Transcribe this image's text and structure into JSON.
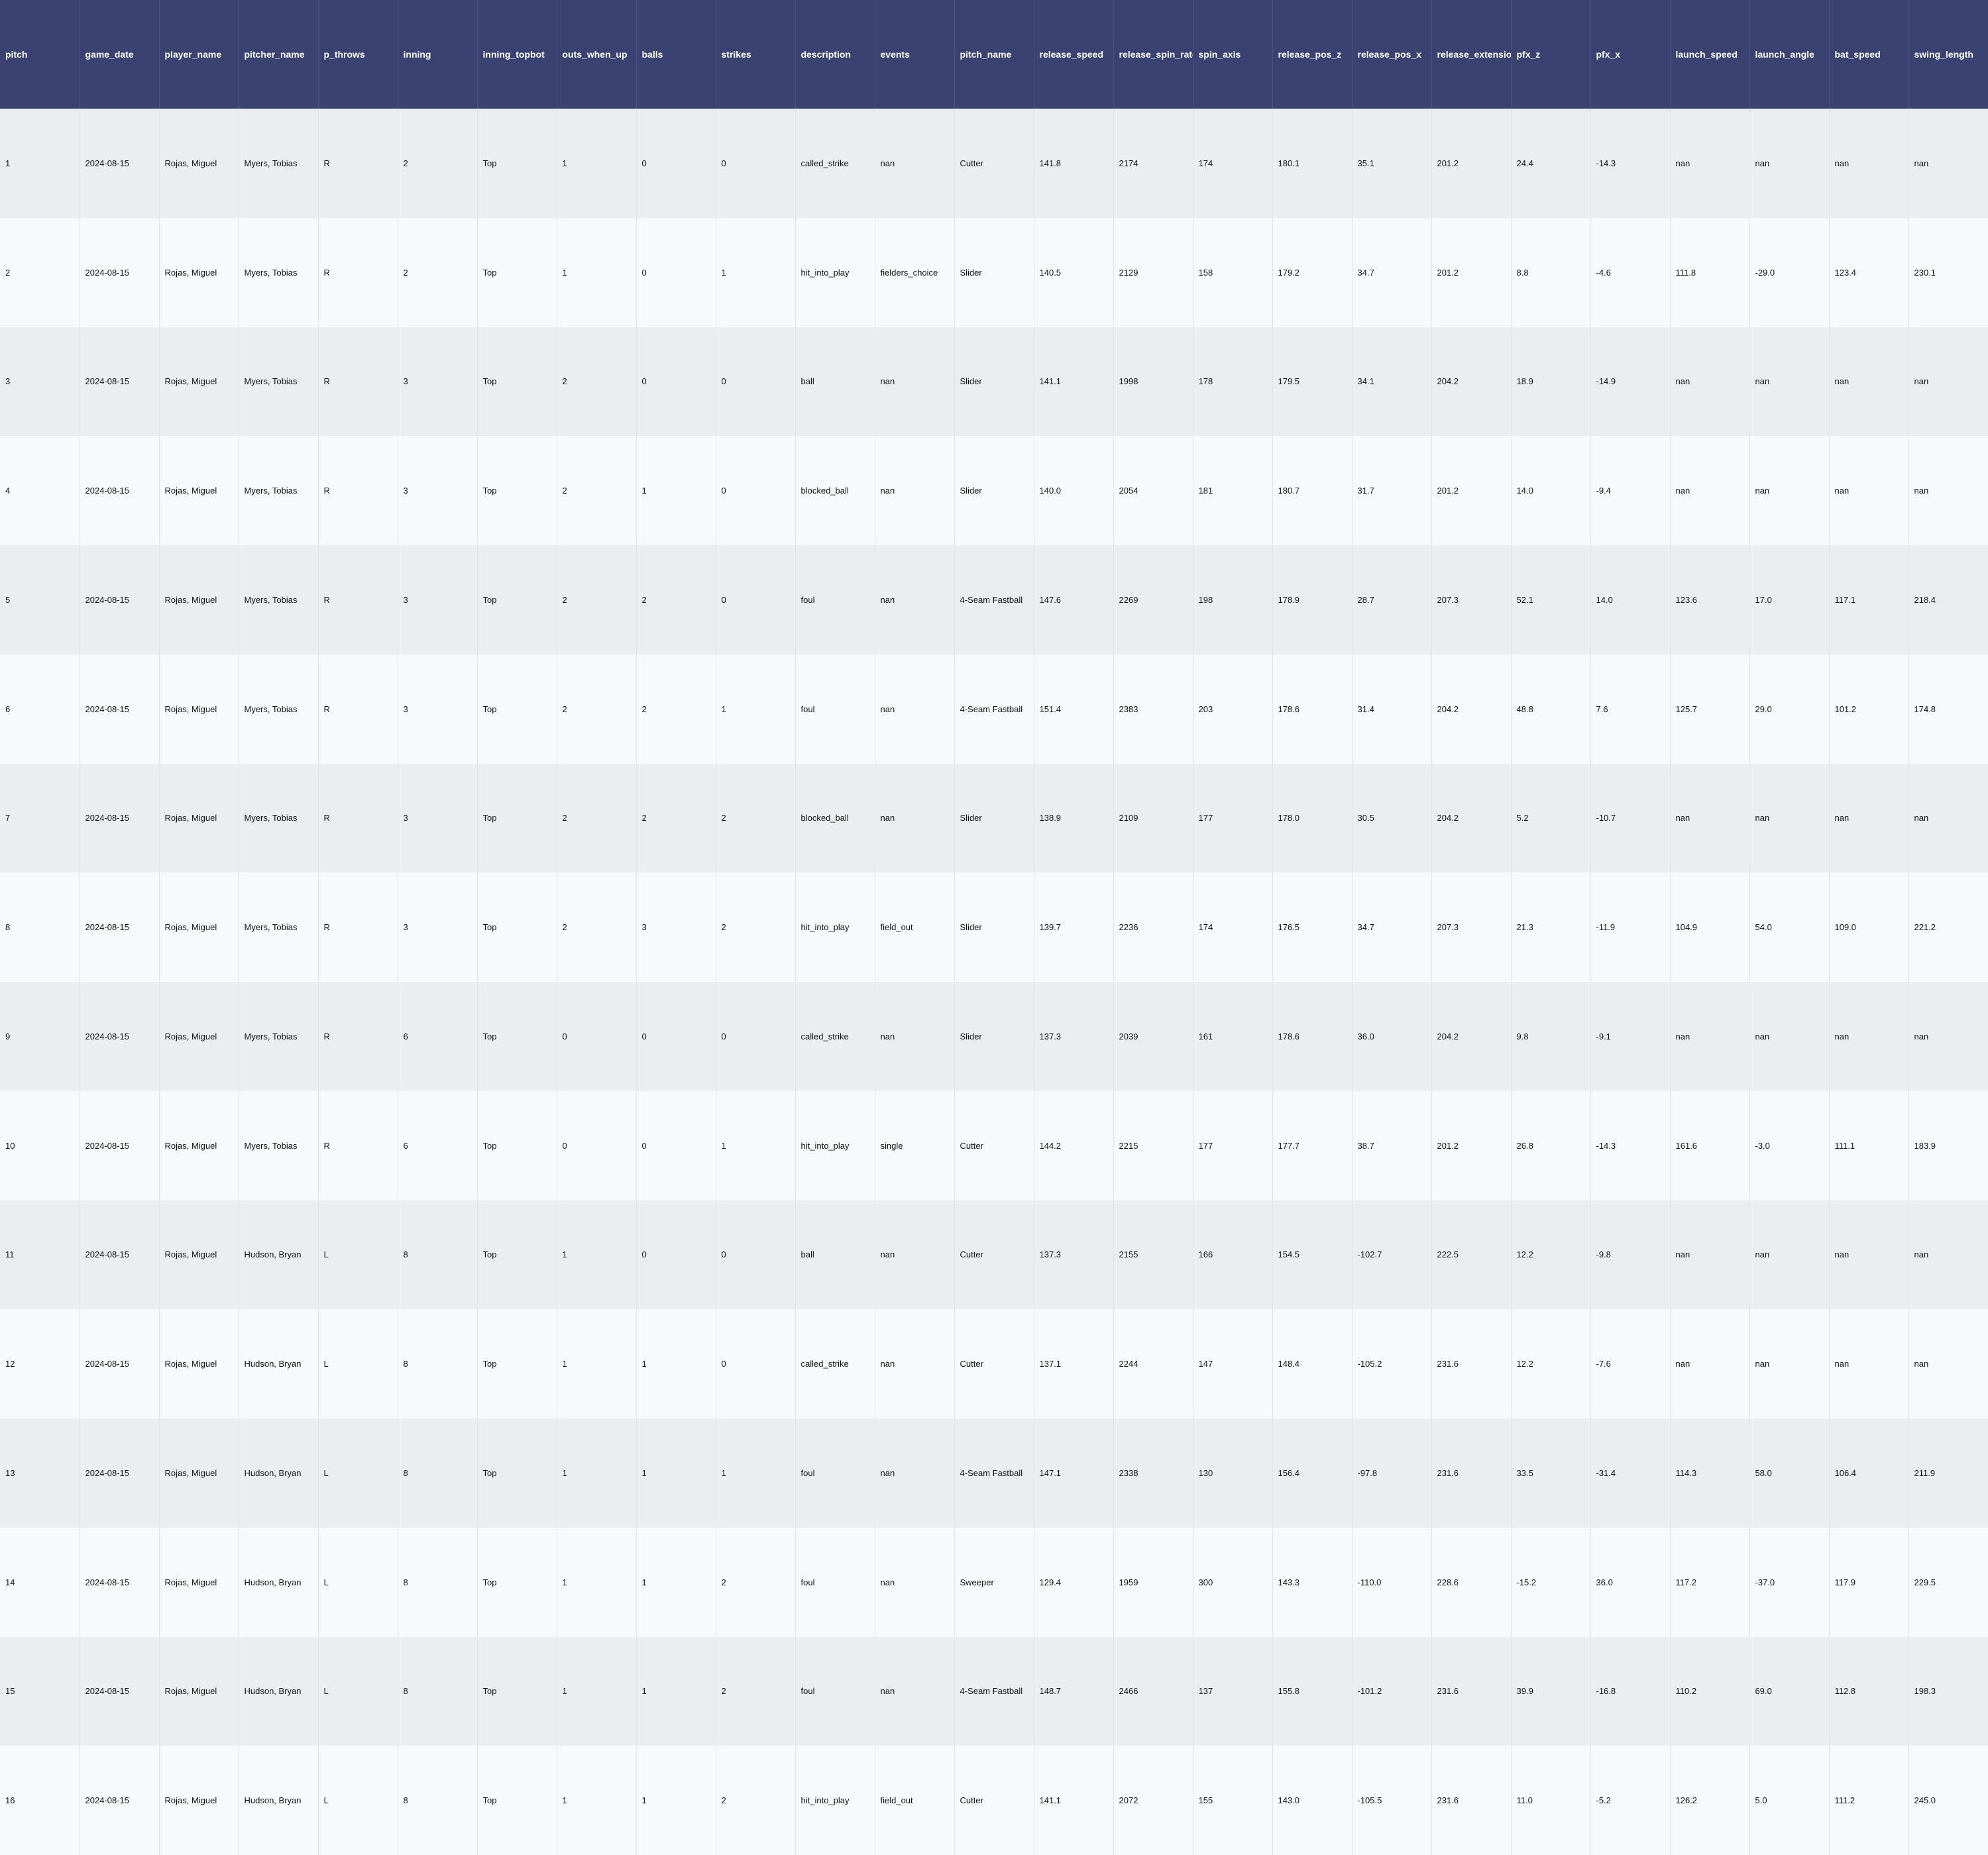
{
  "chart_data": {
    "type": "table",
    "columns": [
      "pitch",
      "game_date",
      "player_name",
      "pitcher_name",
      "p_throws",
      "inning",
      "inning_topbot",
      "outs_when_up",
      "balls",
      "strikes",
      "description",
      "events",
      "pitch_name",
      "release_speed",
      "release_spin_rate",
      "spin_axis",
      "release_pos_z",
      "release_pos_x",
      "release_extension",
      "pfx_z",
      "pfx_x",
      "launch_speed",
      "launch_angle",
      "bat_speed",
      "swing_length"
    ],
    "rows": [
      [
        "1",
        "2024-08-15",
        "Rojas, Miguel",
        "Myers, Tobias",
        "R",
        "2",
        "Top",
        "1",
        "0",
        "0",
        "called_strike",
        "nan",
        "Cutter",
        "141.8",
        "2174",
        "174",
        "180.1",
        "35.1",
        "201.2",
        "24.4",
        "-14.3",
        "nan",
        "nan",
        "nan",
        "nan"
      ],
      [
        "2",
        "2024-08-15",
        "Rojas, Miguel",
        "Myers, Tobias",
        "R",
        "2",
        "Top",
        "1",
        "0",
        "1",
        "hit_into_play",
        "fielders_choice",
        "Slider",
        "140.5",
        "2129",
        "158",
        "179.2",
        "34.7",
        "201.2",
        "8.8",
        "-4.6",
        "111.8",
        "-29.0",
        "123.4",
        "230.1"
      ],
      [
        "3",
        "2024-08-15",
        "Rojas, Miguel",
        "Myers, Tobias",
        "R",
        "3",
        "Top",
        "2",
        "0",
        "0",
        "ball",
        "nan",
        "Slider",
        "141.1",
        "1998",
        "178",
        "179.5",
        "34.1",
        "204.2",
        "18.9",
        "-14.9",
        "nan",
        "nan",
        "nan",
        "nan"
      ],
      [
        "4",
        "2024-08-15",
        "Rojas, Miguel",
        "Myers, Tobias",
        "R",
        "3",
        "Top",
        "2",
        "1",
        "0",
        "blocked_ball",
        "nan",
        "Slider",
        "140.0",
        "2054",
        "181",
        "180.7",
        "31.7",
        "201.2",
        "14.0",
        "-9.4",
        "nan",
        "nan",
        "nan",
        "nan"
      ],
      [
        "5",
        "2024-08-15",
        "Rojas, Miguel",
        "Myers, Tobias",
        "R",
        "3",
        "Top",
        "2",
        "2",
        "0",
        "foul",
        "nan",
        "4-Seam Fastball",
        "147.6",
        "2269",
        "198",
        "178.9",
        "28.7",
        "207.3",
        "52.1",
        "14.0",
        "123.6",
        "17.0",
        "117.1",
        "218.4"
      ],
      [
        "6",
        "2024-08-15",
        "Rojas, Miguel",
        "Myers, Tobias",
        "R",
        "3",
        "Top",
        "2",
        "2",
        "1",
        "foul",
        "nan",
        "4-Seam Fastball",
        "151.4",
        "2383",
        "203",
        "178.6",
        "31.4",
        "204.2",
        "48.8",
        "7.6",
        "125.7",
        "29.0",
        "101.2",
        "174.8"
      ],
      [
        "7",
        "2024-08-15",
        "Rojas, Miguel",
        "Myers, Tobias",
        "R",
        "3",
        "Top",
        "2",
        "2",
        "2",
        "blocked_ball",
        "nan",
        "Slider",
        "138.9",
        "2109",
        "177",
        "178.0",
        "30.5",
        "204.2",
        "5.2",
        "-10.7",
        "nan",
        "nan",
        "nan",
        "nan"
      ],
      [
        "8",
        "2024-08-15",
        "Rojas, Miguel",
        "Myers, Tobias",
        "R",
        "3",
        "Top",
        "2",
        "3",
        "2",
        "hit_into_play",
        "field_out",
        "Slider",
        "139.7",
        "2236",
        "174",
        "176.5",
        "34.7",
        "207.3",
        "21.3",
        "-11.9",
        "104.9",
        "54.0",
        "109.0",
        "221.2"
      ],
      [
        "9",
        "2024-08-15",
        "Rojas, Miguel",
        "Myers, Tobias",
        "R",
        "6",
        "Top",
        "0",
        "0",
        "0",
        "called_strike",
        "nan",
        "Slider",
        "137.3",
        "2039",
        "161",
        "178.6",
        "36.0",
        "204.2",
        "9.8",
        "-9.1",
        "nan",
        "nan",
        "nan",
        "nan"
      ],
      [
        "10",
        "2024-08-15",
        "Rojas, Miguel",
        "Myers, Tobias",
        "R",
        "6",
        "Top",
        "0",
        "0",
        "1",
        "hit_into_play",
        "single",
        "Cutter",
        "144.2",
        "2215",
        "177",
        "177.7",
        "38.7",
        "201.2",
        "26.8",
        "-14.3",
        "161.6",
        "-3.0",
        "111.1",
        "183.9"
      ],
      [
        "11",
        "2024-08-15",
        "Rojas, Miguel",
        "Hudson, Bryan",
        "L",
        "8",
        "Top",
        "1",
        "0",
        "0",
        "ball",
        "nan",
        "Cutter",
        "137.3",
        "2155",
        "166",
        "154.5",
        "-102.7",
        "222.5",
        "12.2",
        "-9.8",
        "nan",
        "nan",
        "nan",
        "nan"
      ],
      [
        "12",
        "2024-08-15",
        "Rojas, Miguel",
        "Hudson, Bryan",
        "L",
        "8",
        "Top",
        "1",
        "1",
        "0",
        "called_strike",
        "nan",
        "Cutter",
        "137.1",
        "2244",
        "147",
        "148.4",
        "-105.2",
        "231.6",
        "12.2",
        "-7.6",
        "nan",
        "nan",
        "nan",
        "nan"
      ],
      [
        "13",
        "2024-08-15",
        "Rojas, Miguel",
        "Hudson, Bryan",
        "L",
        "8",
        "Top",
        "1",
        "1",
        "1",
        "foul",
        "nan",
        "4-Seam Fastball",
        "147.1",
        "2338",
        "130",
        "156.4",
        "-97.8",
        "231.6",
        "33.5",
        "-31.4",
        "114.3",
        "58.0",
        "106.4",
        "211.9"
      ],
      [
        "14",
        "2024-08-15",
        "Rojas, Miguel",
        "Hudson, Bryan",
        "L",
        "8",
        "Top",
        "1",
        "1",
        "2",
        "foul",
        "nan",
        "Sweeper",
        "129.4",
        "1959",
        "300",
        "143.3",
        "-110.0",
        "228.6",
        "-15.2",
        "36.0",
        "117.2",
        "-37.0",
        "117.9",
        "229.5"
      ],
      [
        "15",
        "2024-08-15",
        "Rojas, Miguel",
        "Hudson, Bryan",
        "L",
        "8",
        "Top",
        "1",
        "1",
        "2",
        "foul",
        "nan",
        "4-Seam Fastball",
        "148.7",
        "2466",
        "137",
        "155.8",
        "-101.2",
        "231.6",
        "39.9",
        "-16.8",
        "110.2",
        "69.0",
        "112.8",
        "198.3"
      ],
      [
        "16",
        "2024-08-15",
        "Rojas, Miguel",
        "Hudson, Bryan",
        "L",
        "8",
        "Top",
        "1",
        "1",
        "2",
        "hit_into_play",
        "field_out",
        "Cutter",
        "141.1",
        "2072",
        "155",
        "143.0",
        "-105.5",
        "231.6",
        "11.0",
        "-5.2",
        "126.2",
        "5.0",
        "111.2",
        "245.0"
      ]
    ]
  },
  "colors": {
    "header_bg": "#394271",
    "header_text": "#ffffff",
    "row_odd_bg": "#ecedf1",
    "row_even_bg": "#f8f9fc"
  }
}
